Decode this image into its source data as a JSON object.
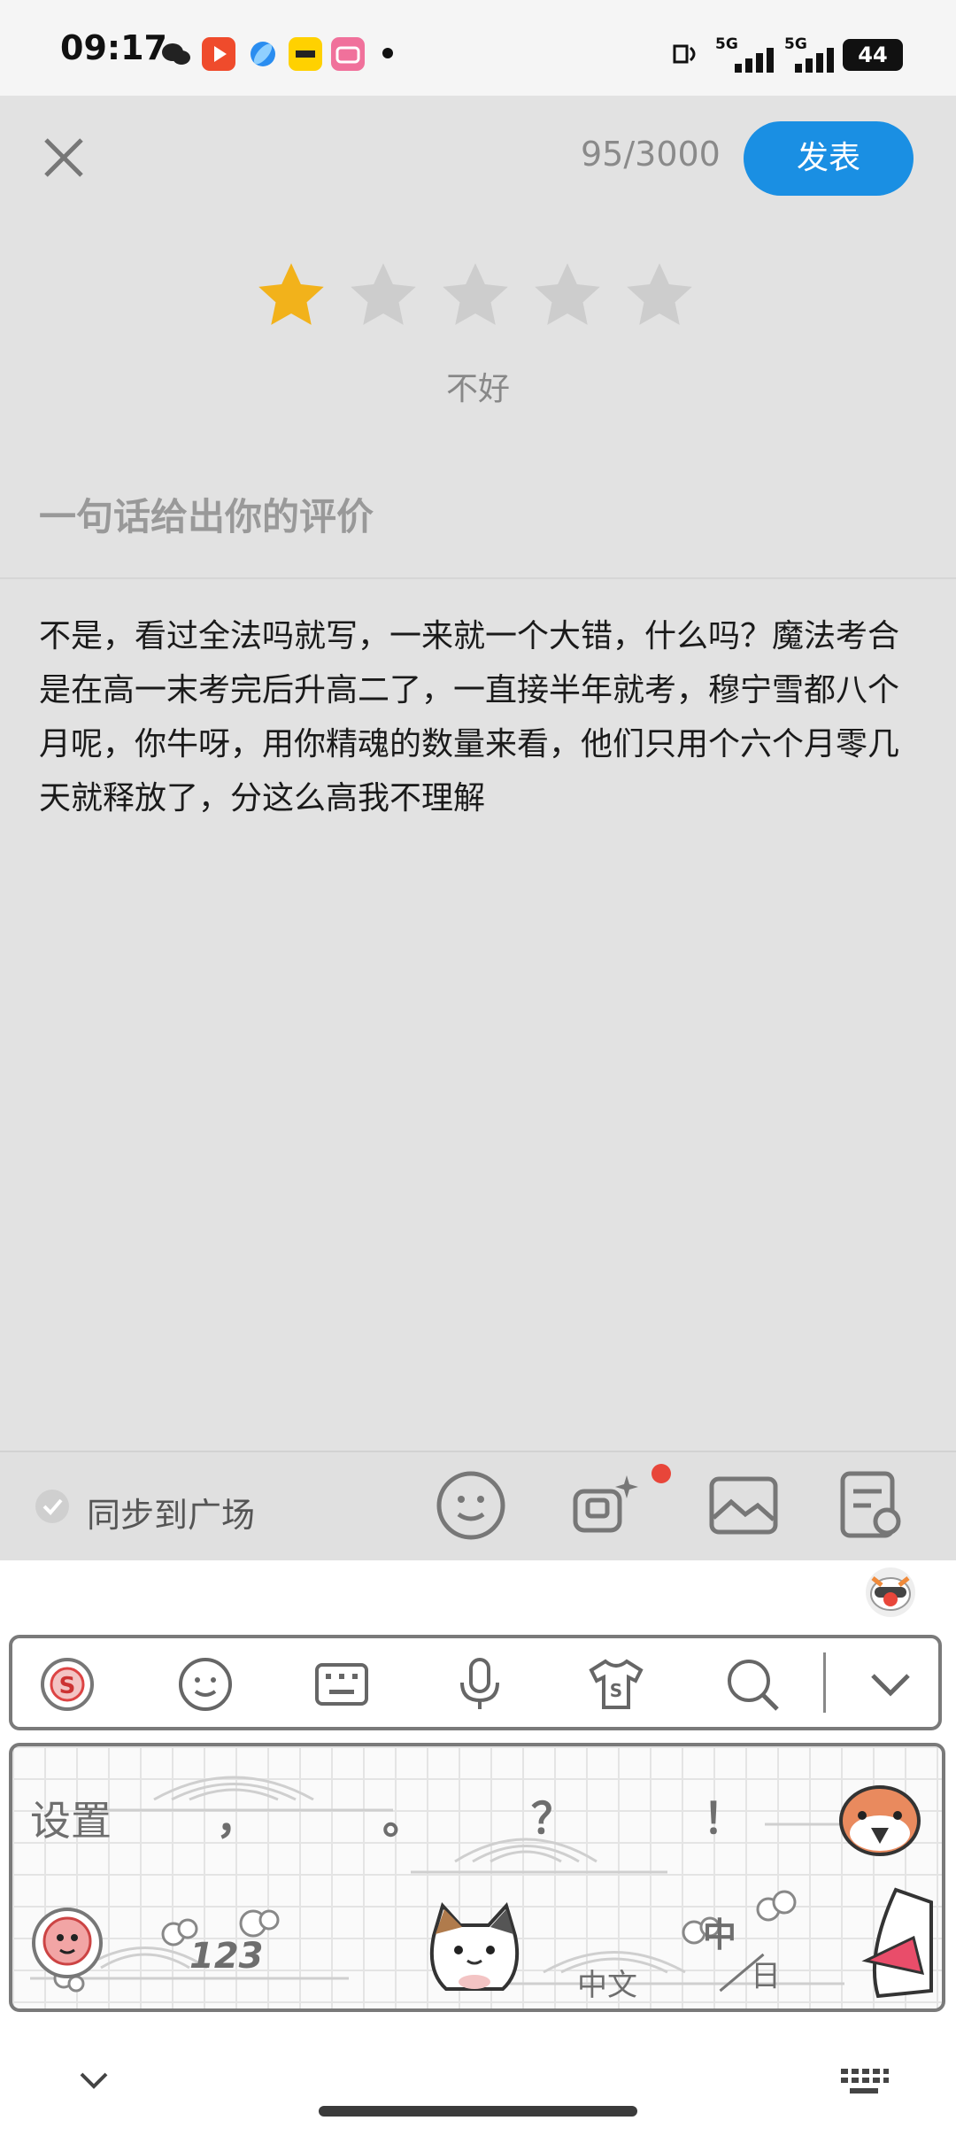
{
  "status_bar": {
    "time": "09:17",
    "network_1": "5G",
    "network_2": "5G",
    "battery": "44"
  },
  "header": {
    "char_counter": "95/3000",
    "publish_label": "发表"
  },
  "rating": {
    "value": 1,
    "max": 5,
    "label": "不好",
    "filled_color": "#f2b21b",
    "empty_color": "#cdcdcd"
  },
  "review": {
    "prompt": "一句话给出你的评价",
    "text": "不是，看过全法吗就写，一来就一个大错，什么吗？魔法考合是在高一末考完后升高二了，一直接半年就考，穆宁雪都八个月呢，你牛呀，用你精魂的数量来看，他们只用个六个月零几天就释放了，分这么高我不理解"
  },
  "toolbar": {
    "sync_label": "同步到广场",
    "icons": [
      "emoji-icon",
      "ai-image-icon",
      "image-icon",
      "note-icon"
    ]
  },
  "keyboard": {
    "toolbar_icons": [
      "brand-logo-icon",
      "emoji-icon",
      "keyboard-icon",
      "microphone-icon",
      "skin-icon",
      "search-icon",
      "chevron-down-icon"
    ],
    "settings_label": "设置",
    "comma_key": "，",
    "period_key": "。",
    "question_key": "？",
    "exclaim_key": "！",
    "num_key": "123",
    "lang_key": "中文",
    "zh_key": "中",
    "ja_key": "日"
  },
  "colors": {
    "accent": "#1a8fe3",
    "editor_bg": "#e2e2e2",
    "badge_red": "#e8463a"
  }
}
